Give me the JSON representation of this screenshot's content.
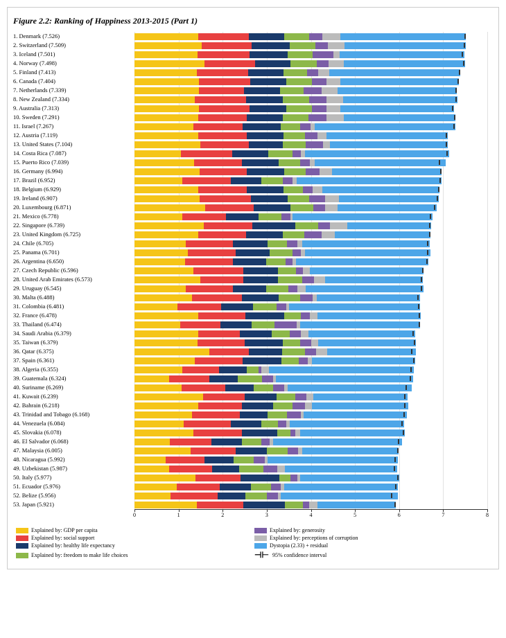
{
  "title": "Figure 2.2: Ranking of Happiness 2013-2015 (Part 1)",
  "colors": {
    "gdp": "#F5C518",
    "social": "#E84040",
    "healthy": "#1A3A6B",
    "freedom": "#8DB84A",
    "generosity": "#7B5EA7",
    "corruption": "#BBBBBB",
    "dystopia": "#4DA6E8",
    "axis": "#333333"
  },
  "legend": [
    {
      "key": "gdp",
      "label": "Explained by: GDP per capita"
    },
    {
      "key": "generosity",
      "label": "Explained by: generosity"
    },
    {
      "key": "social",
      "label": "Explained by: social support"
    },
    {
      "key": "corruption",
      "label": "Explained by: perceptions of corruption"
    },
    {
      "key": "healthy",
      "label": "Explained by: healthy life expectancy"
    },
    {
      "key": "dystopia",
      "label": "Dystopia (2.33) + residual"
    },
    {
      "key": "freedom",
      "label": "Explained by: freedom to make life choices"
    },
    {
      "key": "ci",
      "label": "95% confidence interval"
    }
  ],
  "axis": {
    "ticks": [
      0,
      1,
      2,
      3,
      4,
      5,
      6,
      7,
      8
    ],
    "max": 8
  },
  "countries": [
    {
      "rank": 1,
      "name": "Denmark (7.526)",
      "gdp": 1.44,
      "social": 1.16,
      "healthy": 0.79,
      "freedom": 0.57,
      "generosity": 0.3,
      "corruption": 0.41,
      "dystopia": 2.84,
      "ci": 0.03
    },
    {
      "rank": 2,
      "name": "Switzerland (7.509)",
      "gdp": 1.52,
      "social": 1.14,
      "healthy": 0.86,
      "freedom": 0.58,
      "generosity": 0.29,
      "corruption": 0.38,
      "dystopia": 2.74,
      "ci": 0.04
    },
    {
      "rank": 3,
      "name": "Iceland (7.501)",
      "gdp": 1.43,
      "social": 1.18,
      "healthy": 0.86,
      "freedom": 0.57,
      "generosity": 0.47,
      "corruption": 0.14,
      "dystopia": 2.83,
      "ci": 0.06
    },
    {
      "rank": 4,
      "name": "Norway (7.498)",
      "gdp": 1.58,
      "social": 1.16,
      "healthy": 0.8,
      "freedom": 0.59,
      "generosity": 0.27,
      "corruption": 0.35,
      "dystopia": 2.74,
      "ci": 0.04
    },
    {
      "rank": 5,
      "name": "Finland (7.413)",
      "gdp": 1.41,
      "social": 1.16,
      "healthy": 0.81,
      "freedom": 0.54,
      "generosity": 0.24,
      "corruption": 0.26,
      "dystopia": 2.97,
      "ci": 0.03
    },
    {
      "rank": 6,
      "name": "Canada (7.404)",
      "gdp": 1.46,
      "social": 1.16,
      "healthy": 0.83,
      "freedom": 0.57,
      "generosity": 0.33,
      "corruption": 0.32,
      "dystopia": 2.69,
      "ci": 0.04
    },
    {
      "rank": 7,
      "name": "Netherlands (7.339)",
      "gdp": 1.46,
      "social": 1.03,
      "healthy": 0.81,
      "freedom": 0.54,
      "generosity": 0.4,
      "corruption": 0.36,
      "dystopia": 2.71,
      "ci": 0.04
    },
    {
      "rank": 8,
      "name": "New Zealand (7.334)",
      "gdp": 1.36,
      "social": 1.17,
      "healthy": 0.83,
      "freedom": 0.6,
      "generosity": 0.39,
      "corruption": 0.38,
      "dystopia": 2.59,
      "ci": 0.04
    },
    {
      "rank": 9,
      "name": "Australia (7.313)",
      "gdp": 1.46,
      "social": 1.15,
      "healthy": 0.84,
      "freedom": 0.57,
      "generosity": 0.33,
      "corruption": 0.32,
      "dystopia": 2.57,
      "ci": 0.04
    },
    {
      "rank": 10,
      "name": "Sweden (7.291)",
      "gdp": 1.45,
      "social": 1.09,
      "healthy": 0.83,
      "freedom": 0.58,
      "generosity": 0.4,
      "corruption": 0.39,
      "dystopia": 2.54,
      "ci": 0.03
    },
    {
      "rank": 11,
      "name": "Israel (7.267)",
      "gdp": 1.33,
      "social": 1.12,
      "healthy": 0.87,
      "freedom": 0.43,
      "generosity": 0.25,
      "corruption": 0.08,
      "dystopia": 3.2,
      "ci": 0.05
    },
    {
      "rank": 12,
      "name": "Austria (7.119)",
      "gdp": 1.45,
      "social": 1.09,
      "healthy": 0.84,
      "freedom": 0.49,
      "generosity": 0.28,
      "corruption": 0.21,
      "dystopia": 2.74,
      "ci": 0.05
    },
    {
      "rank": 13,
      "name": "United States (7.104)",
      "gdp": 1.5,
      "social": 1.1,
      "healthy": 0.76,
      "freedom": 0.52,
      "generosity": 0.4,
      "corruption": 0.16,
      "dystopia": 2.66,
      "ci": 0.05
    },
    {
      "rank": 14,
      "name": "Costa Rica (7.087)",
      "gdp": 1.06,
      "social": 1.15,
      "healthy": 0.83,
      "freedom": 0.55,
      "generosity": 0.18,
      "corruption": 0.09,
      "dystopia": 3.27,
      "ci": 0.05
    },
    {
      "rank": 15,
      "name": "Puerto Rico (7.039)",
      "gdp": 1.35,
      "social": 1.09,
      "healthy": 0.83,
      "freedom": 0.49,
      "generosity": 0.22,
      "corruption": 0.1,
      "dystopia": 2.97,
      "ci": 0.15
    },
    {
      "rank": 16,
      "name": "Germany (6.994)",
      "gdp": 1.48,
      "social": 1.07,
      "healthy": 0.84,
      "freedom": 0.49,
      "generosity": 0.32,
      "corruption": 0.28,
      "dystopia": 2.49,
      "ci": 0.04
    },
    {
      "rank": 17,
      "name": "Brazil (6.952)",
      "gdp": 1.08,
      "social": 1.11,
      "healthy": 0.68,
      "freedom": 0.5,
      "generosity": 0.21,
      "corruption": 0.1,
      "dystopia": 3.28,
      "ci": 0.04
    },
    {
      "rank": 18,
      "name": "Belgium (6.929)",
      "gdp": 1.45,
      "social": 1.09,
      "healthy": 0.84,
      "freedom": 0.44,
      "generosity": 0.22,
      "corruption": 0.22,
      "dystopia": 2.66,
      "ci": 0.04
    },
    {
      "rank": 19,
      "name": "Ireland (6.907)",
      "gdp": 1.48,
      "social": 1.16,
      "healthy": 0.83,
      "freedom": 0.49,
      "generosity": 0.36,
      "corruption": 0.32,
      "dystopia": 2.26,
      "ci": 0.05
    },
    {
      "rank": 20,
      "name": "Luxembourg (6.871)",
      "gdp": 1.61,
      "social": 1.09,
      "healthy": 0.84,
      "freedom": 0.51,
      "generosity": 0.27,
      "corruption": 0.28,
      "dystopia": 2.26,
      "ci": 0.07
    },
    {
      "rank": 21,
      "name": "Mexico (6.778)",
      "gdp": 1.09,
      "social": 0.99,
      "healthy": 0.73,
      "freedom": 0.53,
      "generosity": 0.2,
      "corruption": 0.05,
      "dystopia": 3.17,
      "ci": 0.06
    },
    {
      "rank": 22,
      "name": "Singapore (6.739)",
      "gdp": 1.57,
      "social": 1.1,
      "healthy": 0.97,
      "freedom": 0.53,
      "generosity": 0.26,
      "corruption": 0.4,
      "dystopia": 1.89,
      "ci": 0.04
    },
    {
      "rank": 23,
      "name": "United Kingdom (6.725)",
      "gdp": 1.44,
      "social": 1.09,
      "healthy": 0.83,
      "freedom": 0.49,
      "generosity": 0.4,
      "corruption": 0.3,
      "dystopia": 2.16,
      "ci": 0.03
    },
    {
      "rank": 24,
      "name": "Chile (6.705)",
      "gdp": 1.17,
      "social": 1.06,
      "healthy": 0.78,
      "freedom": 0.45,
      "generosity": 0.23,
      "corruption": 0.11,
      "dystopia": 2.89,
      "ci": 0.06
    },
    {
      "rank": 25,
      "name": "Panama (6.701)",
      "gdp": 1.21,
      "social": 1.08,
      "healthy": 0.78,
      "freedom": 0.52,
      "generosity": 0.19,
      "corruption": 0.08,
      "dystopia": 2.85,
      "ci": 0.07
    },
    {
      "rank": 26,
      "name": "Argentina (6.650)",
      "gdp": 1.15,
      "social": 1.08,
      "healthy": 0.76,
      "freedom": 0.43,
      "generosity": 0.17,
      "corruption": 0.08,
      "dystopia": 2.99,
      "ci": 0.05
    },
    {
      "rank": 27,
      "name": "Czech Republic (6.596)",
      "gdp": 1.34,
      "social": 1.12,
      "healthy": 0.8,
      "freedom": 0.41,
      "generosity": 0.15,
      "corruption": 0.15,
      "dystopia": 2.59,
      "ci": 0.04
    },
    {
      "rank": 28,
      "name": "United Arab Emirates (6.573)",
      "gdp": 1.5,
      "social": 0.96,
      "healthy": 0.79,
      "freedom": 0.56,
      "generosity": 0.26,
      "corruption": 0.26,
      "dystopia": 2.21,
      "ci": 0.05
    },
    {
      "rank": 29,
      "name": "Uruguay (6.545)",
      "gdp": 1.16,
      "social": 1.07,
      "healthy": 0.75,
      "freedom": 0.51,
      "generosity": 0.2,
      "corruption": 0.19,
      "dystopia": 2.67,
      "ci": 0.06
    },
    {
      "rank": 30,
      "name": "Malta (6.488)",
      "gdp": 1.3,
      "social": 1.13,
      "healthy": 0.84,
      "freedom": 0.49,
      "generosity": 0.28,
      "corruption": 0.09,
      "dystopia": 2.35,
      "ci": 0.07
    },
    {
      "rank": 31,
      "name": "Colombia (6.481)",
      "gdp": 0.97,
      "social": 0.99,
      "healthy": 0.73,
      "freedom": 0.54,
      "generosity": 0.21,
      "corruption": 0.06,
      "dystopia": 2.98,
      "ci": 0.05
    },
    {
      "rank": 32,
      "name": "France (6.478)",
      "gdp": 1.44,
      "social": 1.07,
      "healthy": 0.88,
      "freedom": 0.38,
      "generosity": 0.2,
      "corruption": 0.18,
      "dystopia": 2.34,
      "ci": 0.04
    },
    {
      "rank": 33,
      "name": "Thailand (6.474)",
      "gdp": 1.03,
      "social": 0.92,
      "healthy": 0.71,
      "freedom": 0.52,
      "generosity": 0.5,
      "corruption": 0.07,
      "dystopia": 2.73,
      "ci": 0.04
    },
    {
      "rank": 34,
      "name": "Saudi Arabia (6.379)",
      "gdp": 1.45,
      "social": 0.94,
      "healthy": 0.72,
      "freedom": 0.41,
      "generosity": 0.25,
      "corruption": 0.18,
      "dystopia": 2.42,
      "ci": 0.07
    },
    {
      "rank": 35,
      "name": "Taiwan (6.379)",
      "gdp": 1.43,
      "social": 1.07,
      "healthy": 0.87,
      "freedom": 0.38,
      "generosity": 0.26,
      "corruption": 0.15,
      "dystopia": 2.22,
      "ci": 0.04
    },
    {
      "rank": 36,
      "name": "Qatar (6.375)",
      "gdp": 1.69,
      "social": 0.91,
      "healthy": 0.75,
      "freedom": 0.52,
      "generosity": 0.25,
      "corruption": 0.25,
      "dystopia": 2.01,
      "ci": 0.11
    },
    {
      "rank": 37,
      "name": "Spain (6.361)",
      "gdp": 1.37,
      "social": 1.08,
      "healthy": 0.89,
      "freedom": 0.38,
      "generosity": 0.21,
      "corruption": 0.1,
      "dystopia": 2.33,
      "ci": 0.04
    },
    {
      "rank": 38,
      "name": "Algeria (6.355)",
      "gdp": 1.08,
      "social": 0.84,
      "healthy": 0.63,
      "freedom": 0.26,
      "generosity": 0.07,
      "corruption": 0.17,
      "dystopia": 3.28,
      "ci": 0.07
    },
    {
      "rank": 39,
      "name": "Guatemala (6.324)",
      "gdp": 0.79,
      "social": 0.9,
      "healthy": 0.66,
      "freedom": 0.55,
      "generosity": 0.24,
      "corruption": 0.07,
      "dystopia": 3.11,
      "ci": 0.08
    },
    {
      "rank": 40,
      "name": "Suriname (6.269)",
      "gdp": 1.07,
      "social": 0.99,
      "healthy": 0.64,
      "freedom": 0.44,
      "generosity": 0.26,
      "corruption": 0.08,
      "dystopia": 2.8,
      "ci": 0.14
    },
    {
      "rank": 41,
      "name": "Kuwait (6.239)",
      "gdp": 1.55,
      "social": 0.95,
      "healthy": 0.72,
      "freedom": 0.43,
      "generosity": 0.25,
      "corruption": 0.16,
      "dystopia": 2.14,
      "ci": 0.09
    },
    {
      "rank": 42,
      "name": "Bahrain (6.218)",
      "gdp": 1.44,
      "social": 0.99,
      "healthy": 0.72,
      "freedom": 0.44,
      "generosity": 0.28,
      "corruption": 0.16,
      "dystopia": 2.18,
      "ci": 0.09
    },
    {
      "rank": 43,
      "name": "Trinidad and Tobago (6.168)",
      "gdp": 1.3,
      "social": 1.09,
      "healthy": 0.63,
      "freedom": 0.44,
      "generosity": 0.31,
      "corruption": 0.06,
      "dystopia": 2.35,
      "ci": 0.08
    },
    {
      "rank": 44,
      "name": "Venezuela (6.084)",
      "gdp": 1.11,
      "social": 1.07,
      "healthy": 0.69,
      "freedom": 0.38,
      "generosity": 0.2,
      "corruption": 0.07,
      "dystopia": 2.6,
      "ci": 0.07
    },
    {
      "rank": 45,
      "name": "Slovakia (6.078)",
      "gdp": 1.33,
      "social": 1.11,
      "healthy": 0.8,
      "freedom": 0.3,
      "generosity": 0.11,
      "corruption": 0.1,
      "dystopia": 2.38,
      "ci": 0.04
    },
    {
      "rank": 46,
      "name": "El Salvador (6.068)",
      "gdp": 0.8,
      "social": 0.95,
      "healthy": 0.68,
      "freedom": 0.44,
      "generosity": 0.2,
      "corruption": 0.08,
      "dystopia": 2.91,
      "ci": 0.08
    },
    {
      "rank": 47,
      "name": "Malaysia (6.005)",
      "gdp": 1.28,
      "social": 1.01,
      "healthy": 0.72,
      "freedom": 0.47,
      "generosity": 0.23,
      "corruption": 0.1,
      "dystopia": 2.18,
      "ci": 0.04
    },
    {
      "rank": 48,
      "name": "Nicaragua (5.992)",
      "gdp": 0.7,
      "social": 0.89,
      "healthy": 0.65,
      "freedom": 0.47,
      "generosity": 0.24,
      "corruption": 0.07,
      "dystopia": 2.96,
      "ci": 0.08
    },
    {
      "rank": 49,
      "name": "Uzbekistan (5.987)",
      "gdp": 0.79,
      "social": 0.97,
      "healthy": 0.62,
      "freedom": 0.55,
      "generosity": 0.31,
      "corruption": 0.17,
      "dystopia": 2.55,
      "ci": 0.08
    },
    {
      "rank": 50,
      "name": "Italy (5.977)",
      "gdp": 1.39,
      "social": 1.02,
      "healthy": 0.88,
      "freedom": 0.24,
      "generosity": 0.16,
      "corruption": 0.07,
      "dystopia": 2.24,
      "ci": 0.04
    },
    {
      "rank": 51,
      "name": "Ecuador (5.976)",
      "gdp": 0.96,
      "social": 0.97,
      "healthy": 0.71,
      "freedom": 0.45,
      "generosity": 0.22,
      "corruption": 0.08,
      "dystopia": 2.59,
      "ci": 0.07
    },
    {
      "rank": 52,
      "name": "Belize (5.956)",
      "gdp": 0.82,
      "social": 1.06,
      "healthy": 0.64,
      "freedom": 0.48,
      "generosity": 0.26,
      "corruption": 0.06,
      "dystopia": 2.65,
      "ci": 0.16
    },
    {
      "rank": 53,
      "name": "Japan (5.921)",
      "gdp": 1.42,
      "social": 1.04,
      "healthy": 0.95,
      "freedom": 0.41,
      "generosity": 0.14,
      "corruption": 0.19,
      "dystopia": 1.78,
      "ci": 0.03
    }
  ]
}
